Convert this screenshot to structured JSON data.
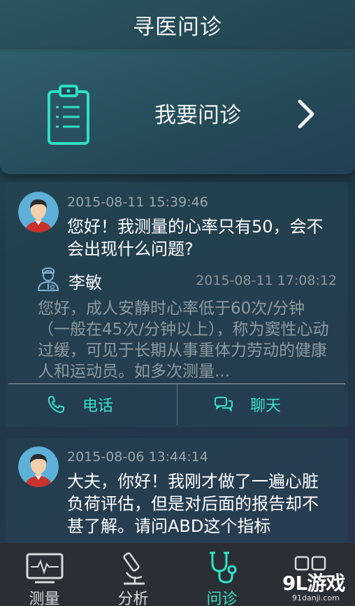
{
  "header": {
    "title": "寻医问诊"
  },
  "ask_card": {
    "label": "我要问诊",
    "icon": "clipboard-icon",
    "accent": "#2fe0c0"
  },
  "consultations": [
    {
      "time": "2015-08-11 15:39:46",
      "question": "您好！我测量的心率只有50，会不会出现什么问题?",
      "doctor": "李敏",
      "doctor_time": "2015-08-11 17:08:12",
      "answer": "您好，成人安静时心率低于60次/分钟（一般在45次/分钟以上），称为窦性心动过缓，可见于长期从事重体力劳动的健康人和运动员。如多次测量...",
      "phone_label": "电话",
      "chat_label": "聊天"
    },
    {
      "time": "2015-08-06 13:44:14",
      "question": "大夫，你好！我刚才做了一遍心脏负荷评估，但是对后面的报告却不甚了解。请问ABD这个指标"
    }
  ],
  "tabs": [
    {
      "label": "测量",
      "icon": "ecg-monitor-icon"
    },
    {
      "label": "分析",
      "icon": "microscope-icon"
    },
    {
      "label": "问诊",
      "icon": "stethoscope-icon",
      "active": true
    },
    {
      "label": "",
      "icon": "more-squares-icon"
    }
  ],
  "watermark": {
    "main": "9L游戏",
    "sub": "91danji.com"
  },
  "colors": {
    "accent": "#33e3c6",
    "tabbar": "#2a2f36"
  }
}
